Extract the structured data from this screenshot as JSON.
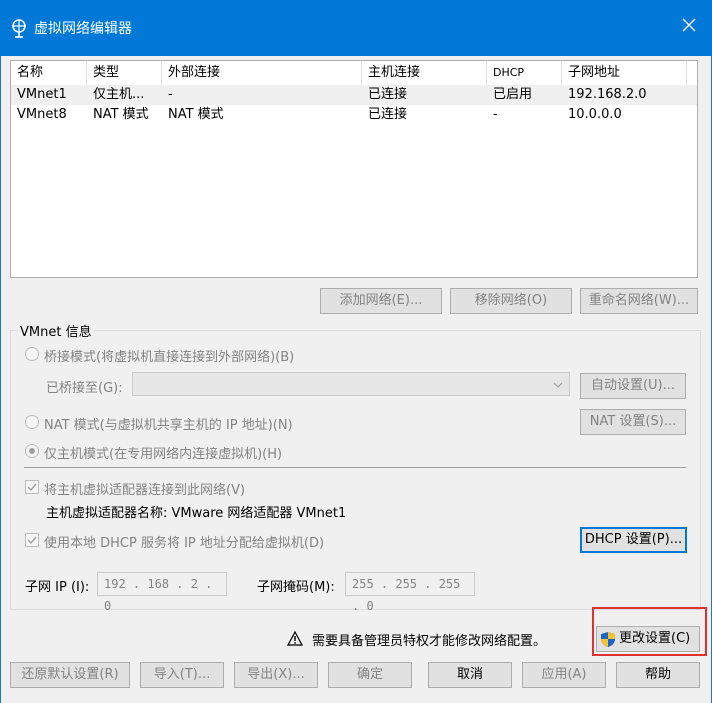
{
  "window": {
    "title": "虚拟网络编辑器"
  },
  "columns": [
    "名称",
    "类型",
    "外部连接",
    "主机连接",
    "DHCP",
    "子网地址"
  ],
  "rows": [
    {
      "name": "VMnet1",
      "type": "仅主机...",
      "external": "-",
      "host": "已连接",
      "dhcp": "已启用",
      "subnet": "192.168.2.0"
    },
    {
      "name": "VMnet8",
      "type": "NAT 模式",
      "external": "NAT 模式",
      "host": "已连接",
      "dhcp": "-",
      "subnet": "10.0.0.0"
    }
  ],
  "list_buttons": {
    "add": "添加网络(E)...",
    "remove": "移除网络(O)",
    "rename": "重命名网络(W)..."
  },
  "vmnet_info": {
    "title": "VMnet 信息",
    "bridge_mode": "桥接模式(将虚拟机直接连接到外部网络)(B)",
    "bridged_to_label": "已桥接至(G):",
    "bridged_to_value": "",
    "auto_settings": "自动设置(U)...",
    "nat_mode": "NAT 模式(与虚拟机共享主机的 IP 地址)(N)",
    "nat_settings": "NAT 设置(S)...",
    "host_only_mode": "仅主机模式(在专用网络内连接虚拟机)(H)",
    "selected_mode": "host_only",
    "connect_adapter": "将主机虚拟适配器连接到此网络(V)",
    "connect_adapter_checked": true,
    "adapter_name": "主机虚拟适配器名称: VMware 网络适配器 VMnet1",
    "use_dhcp": "使用本地 DHCP 服务将 IP 地址分配给虚拟机(D)",
    "use_dhcp_checked": true,
    "dhcp_settings": "DHCP 设置(P)...",
    "subnet_ip_label": "子网 IP (I):",
    "subnet_ip": "192 . 168 .  2  .  0",
    "subnet_mask_label": "子网掩码(M):",
    "subnet_mask": "255 . 255 . 255 .  0"
  },
  "admin": {
    "warning": "需要具备管理员特权才能修改网络配置。",
    "change_settings": "更改设置(C)"
  },
  "bottom_buttons": {
    "restore": "还原默认设置(R)",
    "import": "导入(T)...",
    "export": "导出(X)...",
    "ok": "确定",
    "cancel": "取消",
    "apply": "应用(A)",
    "help": "帮助"
  },
  "colors": {
    "titlebar": "#0078d7",
    "highlight_box": "#e03030",
    "default_button_border": "#0078d7"
  }
}
